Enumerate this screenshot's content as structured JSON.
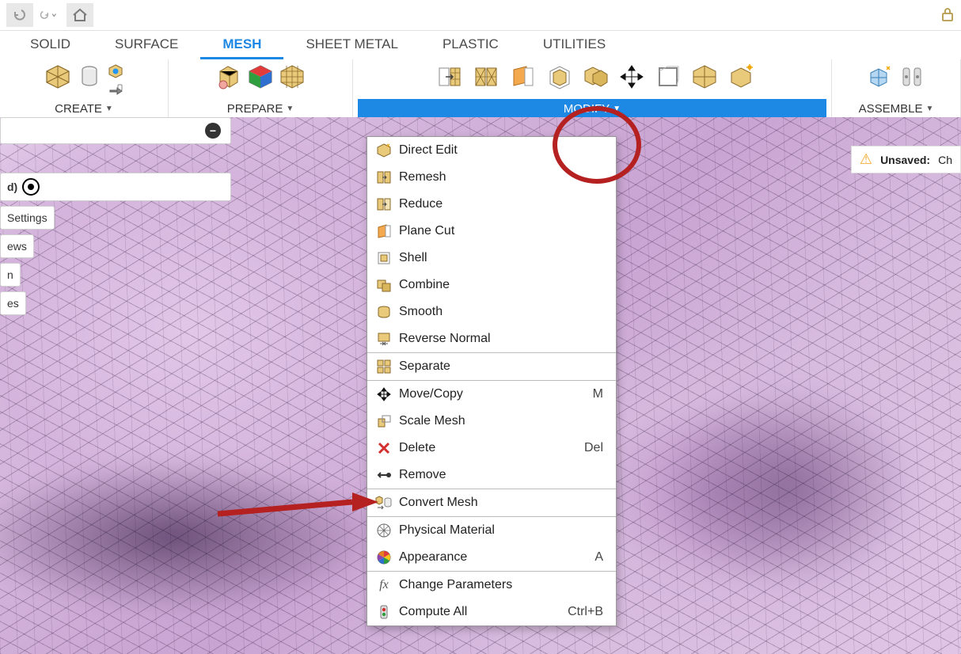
{
  "topbar": {
    "lock_title": "Lock"
  },
  "tabs": {
    "solid": "SOLID",
    "surface": "SURFACE",
    "mesh": "MESH",
    "sheetmetal": "SHEET METAL",
    "plastic": "PLASTIC",
    "utilities": "UTILITIES"
  },
  "panels": {
    "create": "CREATE",
    "prepare": "PREPARE",
    "modify": "MODIFY",
    "assemble": "ASSEMBLE"
  },
  "left": {
    "d_suffix": "d)",
    "settings": "Settings",
    "ews": "ews",
    "n": "n",
    "es": "es"
  },
  "menu": {
    "direct_edit": "Direct Edit",
    "remesh": "Remesh",
    "reduce": "Reduce",
    "plane_cut": "Plane Cut",
    "shell": "Shell",
    "combine": "Combine",
    "smooth": "Smooth",
    "reverse_normal": "Reverse Normal",
    "separate": "Separate",
    "move_copy": "Move/Copy",
    "move_copy_k": "M",
    "scale_mesh": "Scale Mesh",
    "delete": "Delete",
    "delete_k": "Del",
    "remove": "Remove",
    "convert_mesh": "Convert Mesh",
    "physical_material": "Physical Material",
    "appearance": "Appearance",
    "appearance_k": "A",
    "change_parameters": "Change Parameters",
    "compute_all": "Compute All",
    "compute_all_k": "Ctrl+B"
  },
  "status": {
    "unsaved": "Unsaved:",
    "changes": "Ch"
  }
}
